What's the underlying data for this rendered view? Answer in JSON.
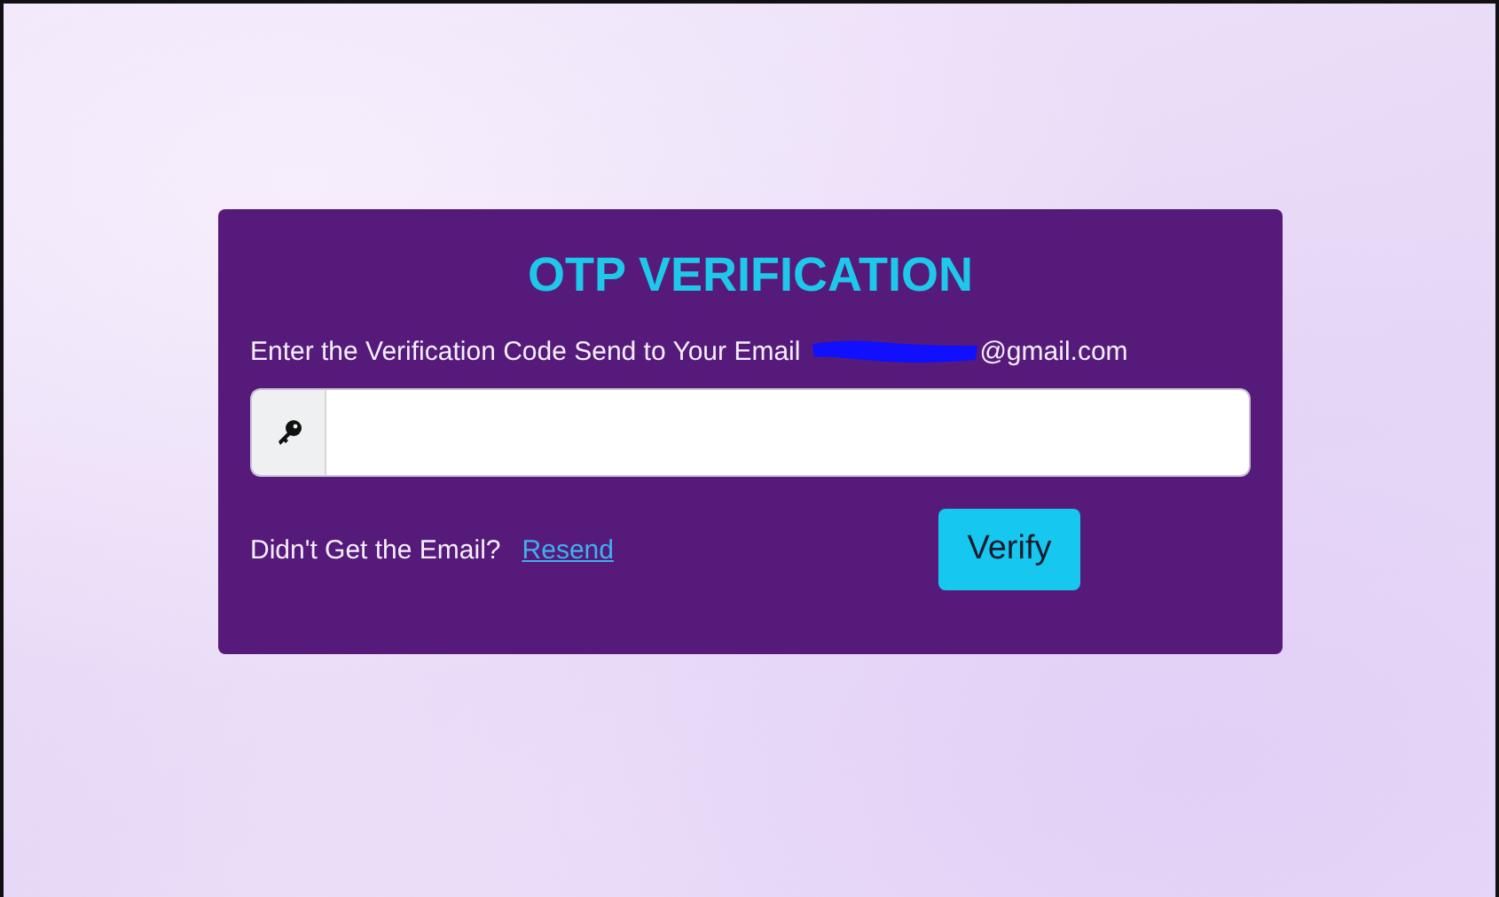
{
  "card": {
    "title": "OTP VERIFICATION",
    "prompt": "Enter the Verification Code Send to Your Email",
    "email": "@gmail.com",
    "resend_prompt": "Didn't Get the Email?",
    "resend_link": "Resend",
    "verify_button": "Verify"
  }
}
